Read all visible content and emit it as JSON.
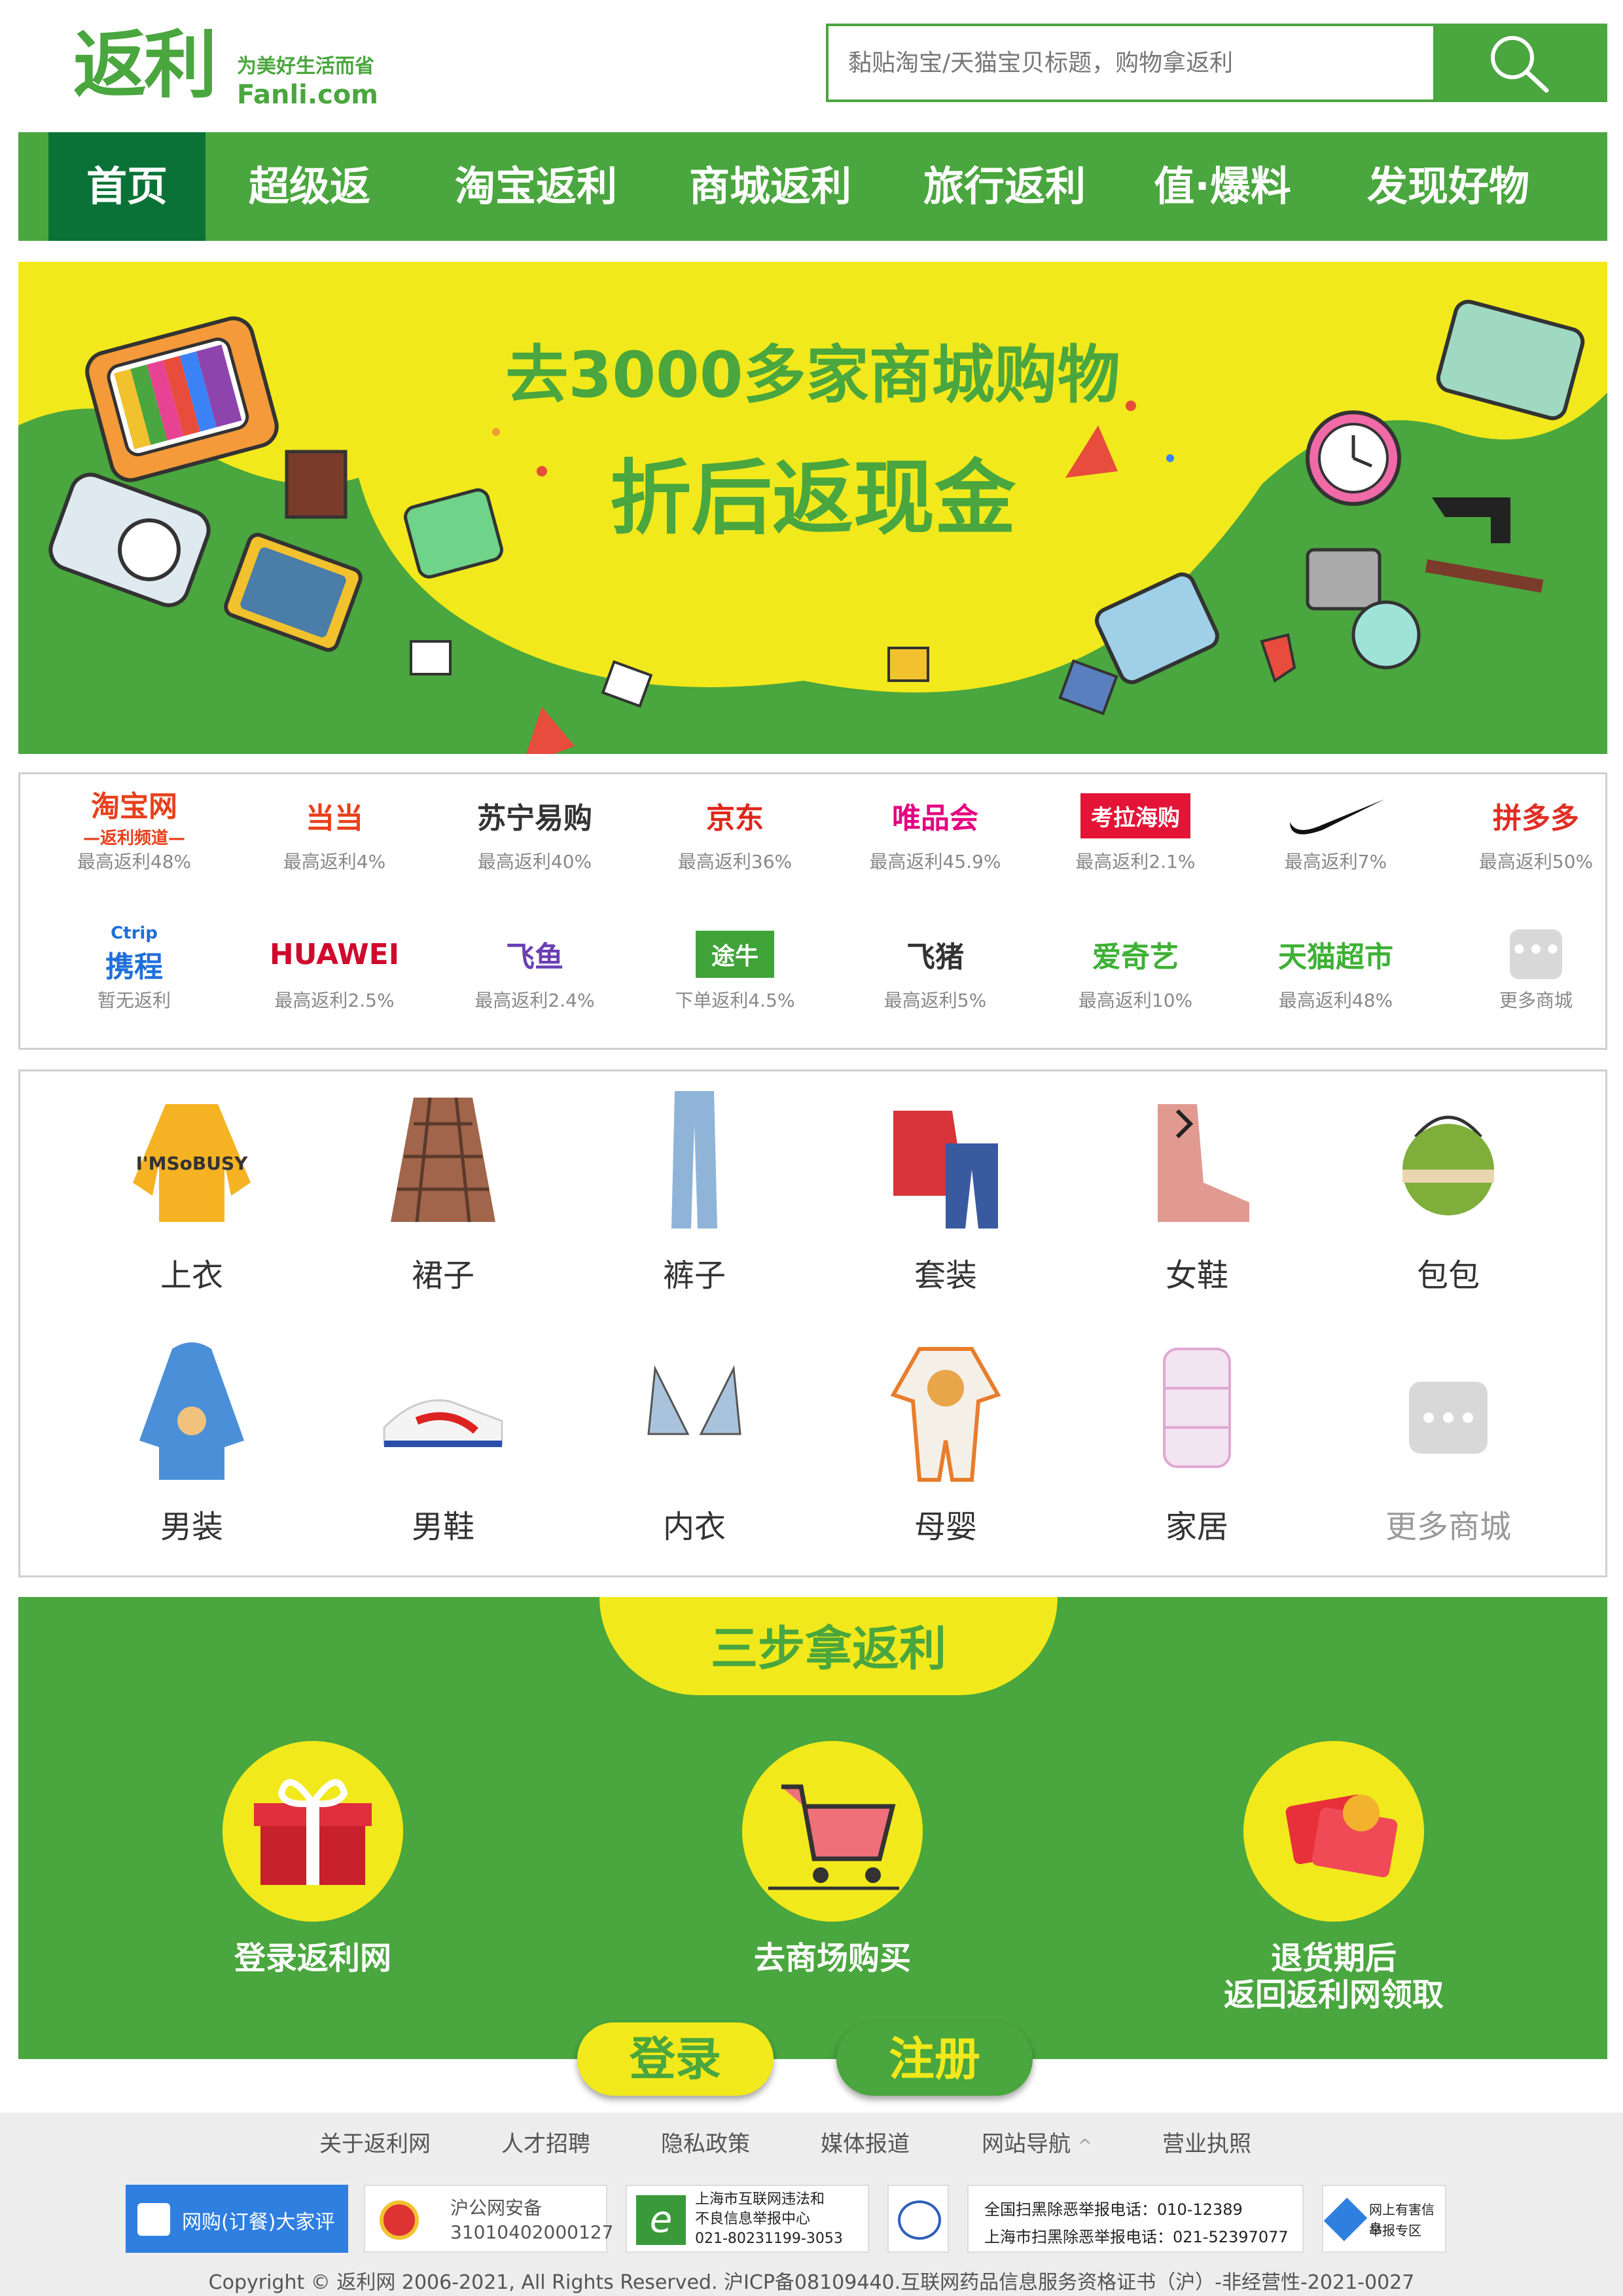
{
  "header": {
    "logo_text": "返利",
    "slogan": "为美好生活而省",
    "domain": "Fanli.com",
    "search_placeholder": "黏贴淘宝/天猫宝贝标题，购物拿返利"
  },
  "nav": {
    "items": [
      "首页",
      "超级返",
      "淘宝返利",
      "商城返利",
      "旅行返利",
      "值·爆料",
      "发现好物"
    ],
    "active": "首页"
  },
  "banner": {
    "line1": "去3000多家商城购物",
    "line2": "折后返现金"
  },
  "merchants": [
    {
      "name": "淘宝网",
      "sub": "—返利频道—",
      "rate": "最高返利48%",
      "color": "#e8401c"
    },
    {
      "name": "当当",
      "rate": "最高返利4%",
      "color": "#e8401c"
    },
    {
      "name": "苏宁易购",
      "rate": "最高返利40%",
      "color": "#333333"
    },
    {
      "name": "京东",
      "rate": "最高返利36%",
      "color": "#e1251b"
    },
    {
      "name": "唯品会",
      "rate": "最高返利45.9%",
      "color": "#e5007f"
    },
    {
      "name": "考拉海购",
      "rate": "最高返利2.1%",
      "color": "#e31436"
    },
    {
      "name": "Nike",
      "rate": "最高返利7%",
      "color": "#111111"
    },
    {
      "name": "拼多多",
      "rate": "最高返利50%",
      "color": "#e02e24"
    },
    {
      "name": "携程",
      "sub": "Ctrip",
      "rate": "暂无返利",
      "color": "#1e6fd9"
    },
    {
      "name": "HUAWEI",
      "rate": "最高返利2.5%",
      "color": "#cf0a2c"
    },
    {
      "name": "飞鱼",
      "rate": "最高返利2.4%",
      "color": "#6a3fb5"
    },
    {
      "name": "途牛",
      "rate": "下单返利4.5%",
      "color": "#3fa33a"
    },
    {
      "name": "飞猪",
      "rate": "最高返利5%",
      "color": "#333333"
    },
    {
      "name": "爱奇艺",
      "rate": "最高返利10%",
      "color": "#3eb035"
    },
    {
      "name": "天猫超市",
      "rate": "最高返利48%",
      "color": "#3eb035"
    },
    {
      "name": "更多商城",
      "rate": "更多商城",
      "color": "#cccccc"
    }
  ],
  "categories": [
    {
      "label": "上衣"
    },
    {
      "label": "裙子"
    },
    {
      "label": "裤子"
    },
    {
      "label": "套装"
    },
    {
      "label": "女鞋"
    },
    {
      "label": "包包"
    },
    {
      "label": "男装"
    },
    {
      "label": "男鞋"
    },
    {
      "label": "内衣"
    },
    {
      "label": "母婴"
    },
    {
      "label": "家居"
    },
    {
      "label": "更多商城"
    }
  ],
  "steps": {
    "title": "三步拿返利",
    "items": [
      {
        "label": "登录返利网"
      },
      {
        "label": "去商场购买"
      },
      {
        "label": "退货期后",
        "label2": "返回返利网领取"
      }
    ]
  },
  "buttons": {
    "login": "登录",
    "register": "注册"
  },
  "footer": {
    "links": [
      "关于返利网",
      "人才招聘",
      "隐私政策",
      "媒体报道",
      "网站导航",
      "营业执照"
    ],
    "nav_arrow": "^",
    "badges": [
      {
        "text": "网购(订餐)大家评"
      },
      {
        "text": "沪公网安备",
        "text2": "31010402000127"
      },
      {
        "text": "上海市互联网违法和",
        "text2": "不良信息举报中心",
        "text3": "021-80231199-3053"
      },
      {
        "text": "全国扫黑除恶举报电话：010-12389",
        "text2": "上海市扫黑除恶举报电话：021-52397077"
      },
      {
        "text": "网上有害信息",
        "text2": "举报专区"
      }
    ],
    "copyright": "Copyright © 返利网 2006-2021, All Rights Reserved. 沪ICP备08109440.互联网药品信息服务资格证书（沪）-非经营性-2021-0027"
  },
  "colors": {
    "brand_green": "#4aa63e",
    "dark_green": "#0a7236",
    "yellow": "#f1e91b"
  }
}
